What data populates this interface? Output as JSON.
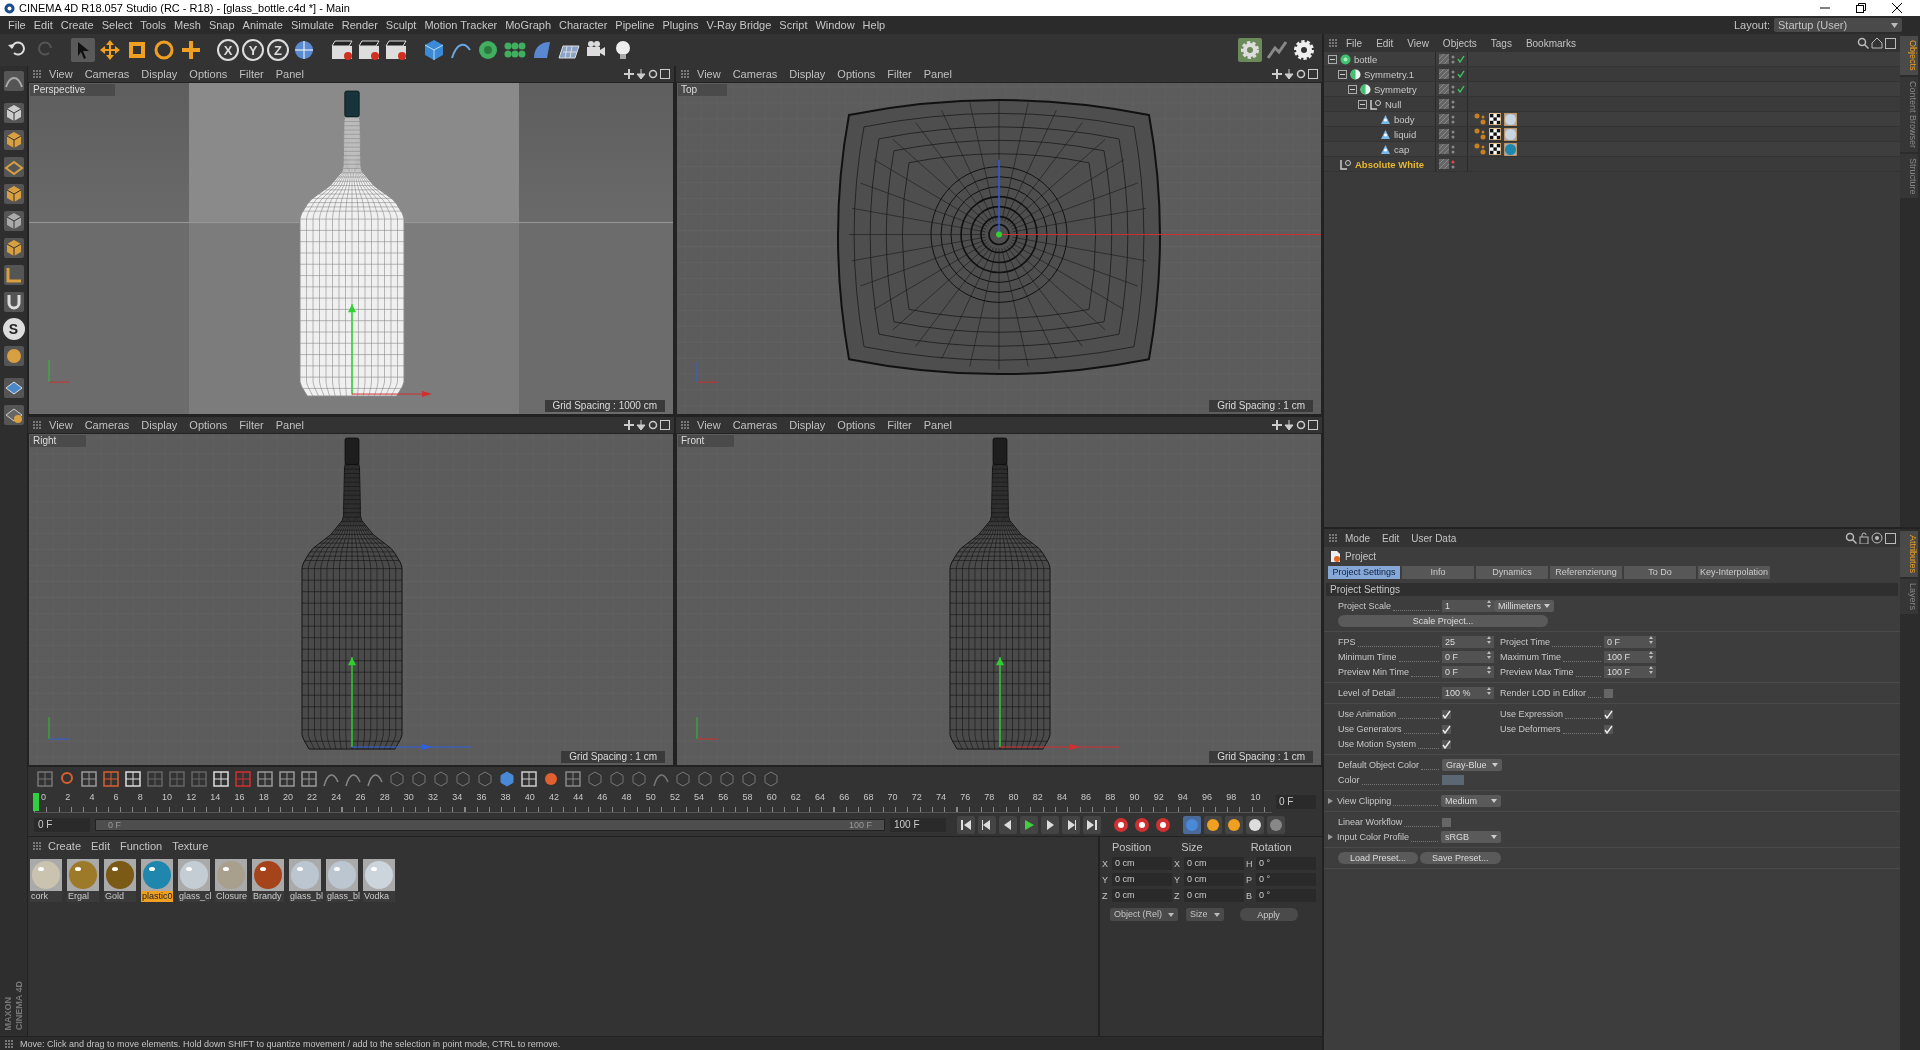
{
  "window": {
    "title": "CINEMA 4D R18.057 Studio (RC - R18) - [glass_bottle.c4d *] - Main"
  },
  "menu": [
    "File",
    "Edit",
    "Create",
    "Select",
    "Tools",
    "Mesh",
    "Snap",
    "Animate",
    "Simulate",
    "Render",
    "Sculpt",
    "Motion Tracker",
    "MoGraph",
    "Character",
    "Pipeline",
    "Plugins",
    "V-Ray Bridge",
    "Script",
    "Window",
    "Help"
  ],
  "layout": {
    "label": "Layout:",
    "value": "Startup (User)"
  },
  "toolbar": {
    "axis_letters": [
      "X",
      "Y",
      "Z"
    ]
  },
  "left_tools": {
    "snap_letter": "S"
  },
  "logo": [
    "MAXON",
    "CINEMA 4D"
  ],
  "viewports": [
    {
      "kind": "perspective",
      "label": "Perspective",
      "menu": [
        "View",
        "Cameras",
        "Display",
        "Options",
        "Filter",
        "Panel"
      ],
      "grid_spacing": "Grid Spacing : 1000 cm"
    },
    {
      "kind": "top",
      "label": "Top",
      "menu": [
        "View",
        "Cameras",
        "Display",
        "Options",
        "Filter",
        "Panel"
      ],
      "grid_spacing": "Grid Spacing : 1 cm"
    },
    {
      "kind": "right",
      "label": "Right",
      "menu": [
        "View",
        "Cameras",
        "Display",
        "Options",
        "Filter",
        "Panel"
      ],
      "grid_spacing": "Grid Spacing : 1 cm"
    },
    {
      "kind": "front",
      "label": "Front",
      "menu": [
        "View",
        "Cameras",
        "Display",
        "Options",
        "Filter",
        "Panel"
      ],
      "grid_spacing": "Grid Spacing : 1 cm"
    }
  ],
  "timeline": {
    "ticks": [
      "0",
      "2",
      "4",
      "6",
      "8",
      "10",
      "12",
      "14",
      "16",
      "18",
      "20",
      "22",
      "24",
      "26",
      "28",
      "30",
      "32",
      "34",
      "36",
      "38",
      "40",
      "42",
      "44",
      "46",
      "48",
      "50",
      "52",
      "54",
      "56",
      "58",
      "60",
      "62",
      "64",
      "66",
      "68",
      "70",
      "72",
      "74",
      "76",
      "78",
      "80",
      "82",
      "84",
      "86",
      "88",
      "90",
      "92",
      "94",
      "96",
      "98",
      "10"
    ],
    "level": 0,
    "current_frame": "0 F",
    "start": "0 F",
    "range": {
      "start": "0 F",
      "end": "100 F",
      "level": 1
    },
    "end": "100 F"
  },
  "materials": {
    "menu": [
      "Create",
      "Edit",
      "Function",
      "Texture"
    ],
    "items": [
      {
        "name": "cork",
        "color": "#c9c3b0",
        "selected": false
      },
      {
        "name": "Ergal",
        "color": "#9c7a2a",
        "selected": false
      },
      {
        "name": "Gold",
        "color": "#7a5a14",
        "selected": false
      },
      {
        "name": "plastic0",
        "color": "#1f86ad",
        "selected": true
      },
      {
        "name": "glass_cl",
        "color": "#c4ccd4",
        "selected": false
      },
      {
        "name": "Closure",
        "color": "#a8a08c",
        "selected": false
      },
      {
        "name": "Brandy",
        "color": "#a5441a",
        "selected": false
      },
      {
        "name": "glass_bl",
        "color": "#bcc6d0",
        "selected": false
      },
      {
        "name": "glass_bl",
        "color": "#bcc6d0",
        "selected": false
      },
      {
        "name": "Vodka",
        "color": "#ccd4dc",
        "selected": false
      }
    ]
  },
  "coordinates": {
    "headers": [
      "Position",
      "Size",
      "Rotation"
    ],
    "rows": [
      {
        "axis": "X",
        "position": "0 cm",
        "size_axis": "X",
        "size": "0 cm",
        "rotation_axis": "H",
        "rotation": "0 °"
      },
      {
        "axis": "Y",
        "position": "0 cm",
        "size_axis": "Y",
        "size": "0 cm",
        "rotation_axis": "P",
        "rotation": "0 °"
      },
      {
        "axis": "Z",
        "position": "0 cm",
        "size_axis": "Z",
        "size": "0 cm",
        "rotation_axis": "B",
        "rotation": "0 °"
      }
    ],
    "mode": "Object (Rel)",
    "size_mode": "Size",
    "apply": "Apply"
  },
  "objects": {
    "menu": [
      "File",
      "Edit",
      "View",
      "Objects",
      "Tags",
      "Bookmarks"
    ],
    "tree": [
      {
        "name": "bottle",
        "kind": "generator",
        "checked": true,
        "editor_hidden": false,
        "expanded": true,
        "children": [
          {
            "name": "Symmetry.1",
            "kind": "symmetry",
            "checked": true,
            "editor_hidden": false,
            "expanded": true,
            "children": [
              {
                "name": "Symmetry",
                "kind": "symmetry",
                "checked": true,
                "editor_hidden": false,
                "expanded": true,
                "children": [
                  {
                    "name": "Null",
                    "kind": "null",
                    "checked": false,
                    "editor_hidden": false,
                    "expanded": true,
                    "children": [
                      {
                        "name": "body",
                        "kind": "polygon",
                        "checked": false,
                        "editor_hidden": false,
                        "tags": [
                          {
                            "kind": "phong"
                          },
                          {
                            "kind": "uvw"
                          },
                          {
                            "kind": "material",
                            "color": "#c8d4e0"
                          }
                        ]
                      },
                      {
                        "name": "liquid",
                        "kind": "polygon",
                        "checked": false,
                        "editor_hidden": false,
                        "tags": [
                          {
                            "kind": "phong"
                          },
                          {
                            "kind": "uvw"
                          },
                          {
                            "kind": "material",
                            "color": "#c8d4e0"
                          }
                        ]
                      },
                      {
                        "name": "cap",
                        "kind": "polygon",
                        "checked": false,
                        "editor_hidden": false,
                        "tags": [
                          {
                            "kind": "phong"
                          },
                          {
                            "kind": "uvw"
                          },
                          {
                            "kind": "material",
                            "color": "#1f86ad"
                          }
                        ]
                      }
                    ]
                  }
                ]
              }
            ]
          }
        ]
      },
      {
        "name": "Absolute White",
        "kind": "null",
        "checked": false,
        "editor_hidden": true,
        "color": "#e8b830"
      }
    ],
    "side_tabs": [
      {
        "label": "Objects",
        "selected": true
      },
      {
        "label": "Content Browser",
        "selected": false
      },
      {
        "label": "Structure",
        "selected": false
      }
    ]
  },
  "attributes": {
    "menu": [
      "Mode",
      "Edit",
      "User Data"
    ],
    "title": "Project",
    "tabs": [
      {
        "label": "Project Settings",
        "selected": true
      },
      {
        "label": "Info",
        "selected": false
      },
      {
        "label": "Dynamics",
        "selected": false
      },
      {
        "label": "Referenzierung",
        "selected": false
      },
      {
        "label": "To Do",
        "selected": false
      },
      {
        "label": "Key-Interpolation",
        "selected": false
      }
    ],
    "section": "Project Settings",
    "groups": [
      [
        [
          {
            "kind": "number",
            "label": "Project Scale",
            "value": "1"
          },
          {
            "kind": "dropdown",
            "value": "Millimeters"
          }
        ],
        [
          {
            "kind": "button",
            "label": "Scale Project..."
          }
        ]
      ],
      [
        [
          {
            "kind": "number",
            "label": "FPS",
            "value": "25"
          },
          {
            "kind": "number",
            "label": "Project Time",
            "value": "0 F"
          }
        ],
        [
          {
            "kind": "number",
            "label": "Minimum Time",
            "value": "0 F"
          },
          {
            "kind": "number",
            "label": "Maximum Time",
            "value": "100 F"
          }
        ],
        [
          {
            "kind": "number",
            "label": "Preview Min Time",
            "value": "0 F"
          },
          {
            "kind": "number",
            "label": "Preview Max Time",
            "value": "100 F"
          }
        ]
      ],
      [
        [
          {
            "kind": "number",
            "label": "Level of Detail",
            "value": "100 %"
          },
          {
            "kind": "checkbox",
            "label": "Render LOD in Editor",
            "checked": false
          }
        ]
      ],
      [
        [
          {
            "kind": "checkbox",
            "label": "Use Animation",
            "checked": true
          },
          {
            "kind": "checkbox",
            "label": "Use Expression",
            "checked": true
          }
        ],
        [
          {
            "kind": "checkbox",
            "label": "Use Generators",
            "checked": true
          },
          {
            "kind": "checkbox",
            "label": "Use Deformers",
            "checked": true
          }
        ],
        [
          {
            "kind": "checkbox",
            "label": "Use Motion System",
            "checked": true
          }
        ]
      ],
      [
        [
          {
            "kind": "dropdown",
            "label": "Default Object Color",
            "value": "Gray-Blue"
          }
        ],
        [
          {
            "kind": "color",
            "label": "Color",
            "color": "#5b6873"
          }
        ]
      ],
      [
        [
          {
            "kind": "dropdown",
            "label": "View Clipping",
            "value": "Medium",
            "expander": true
          }
        ]
      ],
      [
        [
          {
            "kind": "checkbox",
            "label": "Linear Workflow",
            "checked": false
          }
        ],
        [
          {
            "kind": "dropdown",
            "label": "Input Color Profile",
            "value": "sRGB",
            "expander": true
          }
        ]
      ],
      [
        [
          {
            "kind": "button",
            "label": "Load Preset..."
          },
          {
            "kind": "button",
            "label": "Save Preset..."
          }
        ]
      ]
    ],
    "side_tabs": [
      {
        "label": "Attributes",
        "selected": true
      },
      {
        "label": "Layers",
        "selected": false
      }
    ]
  },
  "status_bar": "Move: Click and drag to move elements. Hold down SHIFT to quantize movement / add to the selection in point mode, CTRL to remove."
}
